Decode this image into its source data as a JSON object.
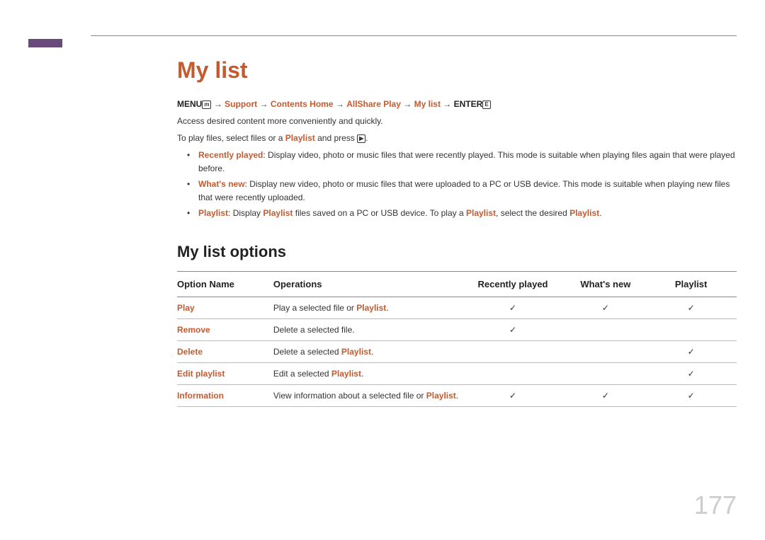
{
  "title": "My list",
  "breadcrumb": {
    "menu": "MENU",
    "menu_icon": "m",
    "arrow": "→",
    "support": "Support",
    "contents_home": "Contents Home",
    "allshare_play": "AllShare Play",
    "my_list": "My list",
    "enter": "ENTER",
    "enter_icon": "E"
  },
  "intro1": "Access desired content more conveniently and quickly.",
  "intro2_a": "To play files, select files or a ",
  "intro2_term": "Playlist",
  "intro2_b": " and press ",
  "intro2_icon": "▶",
  "intro2_c": ".",
  "bullets": [
    {
      "term": "Recently played",
      "text": ": Display video, photo or music files that were recently played. This mode is suitable when playing files again that were played before."
    },
    {
      "term": "What's new",
      "text": ": Display new video, photo or music files that were uploaded to a PC or USB device. This mode is suitable when playing new files that were recently uploaded."
    },
    {
      "term": "Playlist",
      "text_a": ": Display ",
      "term2": "Playlist",
      "text_b": " files saved on a PC or USB device. To play a ",
      "term3": "Playlist",
      "text_c": ", select the desired ",
      "term4": "Playlist",
      "text_d": "."
    }
  ],
  "subhead": "My list options",
  "table": {
    "headers": {
      "name": "Option Name",
      "operations": "Operations",
      "recent": "Recently played",
      "new": "What's new",
      "playlist": "Playlist"
    },
    "rows": [
      {
        "name": "Play",
        "op_a": "Play a selected file or ",
        "op_term": "Playlist",
        "op_b": ".",
        "recent": "✓",
        "new": "✓",
        "playlist": "✓"
      },
      {
        "name": "Remove",
        "op_a": "Delete a selected file.",
        "op_term": "",
        "op_b": "",
        "recent": "✓",
        "new": "",
        "playlist": ""
      },
      {
        "name": "Delete",
        "op_a": "Delete a selected ",
        "op_term": "Playlist",
        "op_b": ".",
        "recent": "",
        "new": "",
        "playlist": "✓"
      },
      {
        "name": "Edit playlist",
        "op_a": "Edit a selected ",
        "op_term": "Playlist",
        "op_b": ".",
        "recent": "",
        "new": "",
        "playlist": "✓"
      },
      {
        "name": "Information",
        "op_a": "View information about a selected file or ",
        "op_term": "Playlist",
        "op_b": ".",
        "recent": "✓",
        "new": "✓",
        "playlist": "✓"
      }
    ]
  },
  "page_number": "177"
}
